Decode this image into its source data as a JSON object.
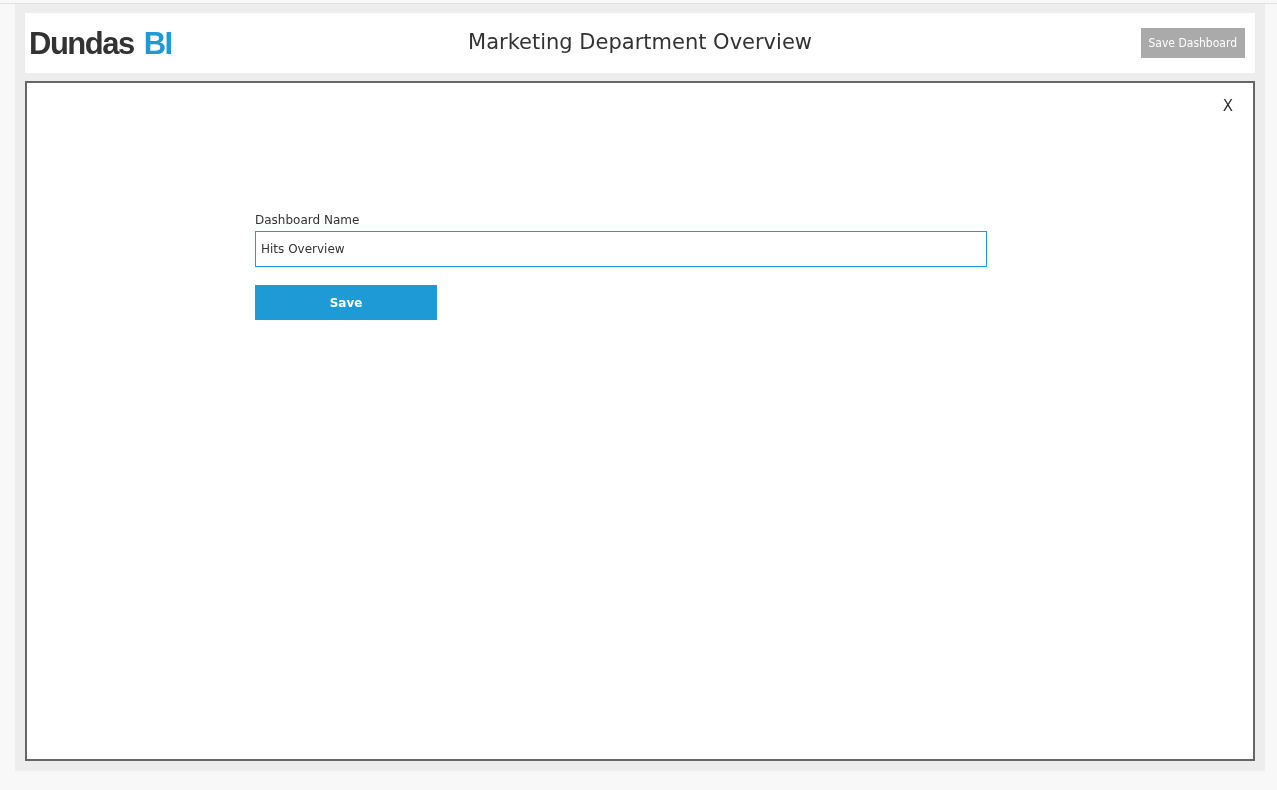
{
  "header": {
    "logo": {
      "name": "Dundas",
      "mark": "BI"
    },
    "title": "Marketing Department Overview",
    "save_button": {
      "label": "Save Dashboard",
      "disabled": true
    }
  },
  "dialog": {
    "close": "X",
    "field": {
      "label": "Dashboard Name",
      "value": "Hits Overview"
    },
    "button": "Save"
  }
}
